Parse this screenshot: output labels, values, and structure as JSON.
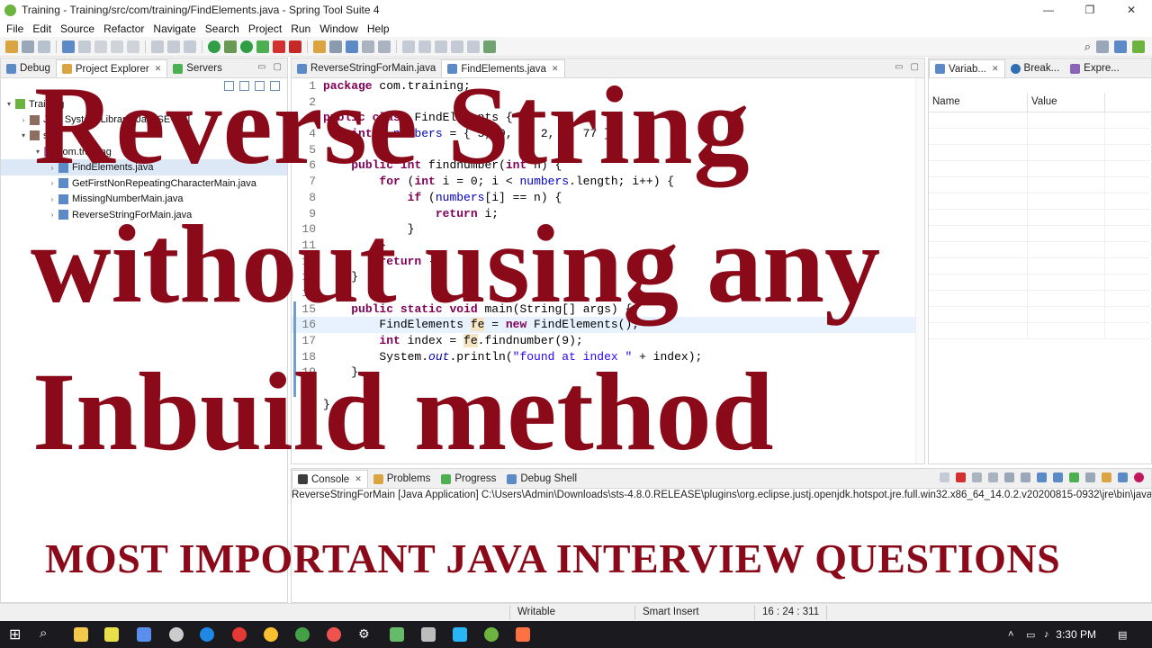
{
  "window": {
    "title": "Training - Training/src/com/training/FindElements.java - Spring Tool Suite 4",
    "controls": [
      "—",
      "❐",
      "✕"
    ]
  },
  "menu": [
    "File",
    "Edit",
    "Source",
    "Refactor",
    "Navigate",
    "Search",
    "Project",
    "Run",
    "Window",
    "Help"
  ],
  "left_panel": {
    "tabs": [
      "Debug",
      "Project Explorer",
      "Servers"
    ],
    "tree": [
      {
        "label": "Training",
        "indent": 0,
        "arrow": "▾"
      },
      {
        "label": "JRE System Library [JavaSE-1.8]",
        "indent": 1,
        "arrow": "›"
      },
      {
        "label": "src",
        "indent": 1,
        "arrow": "▾"
      },
      {
        "label": "com.training",
        "indent": 2,
        "arrow": "▾"
      },
      {
        "label": "FindElements.java",
        "indent": 3,
        "arrow": "›",
        "selected": true
      },
      {
        "label": "GetFirstNonRepeatingCharacterMain.java",
        "indent": 3,
        "arrow": "›"
      },
      {
        "label": "MissingNumberMain.java",
        "indent": 3,
        "arrow": "›"
      },
      {
        "label": "ReverseStringForMain.java",
        "indent": 3,
        "arrow": "›"
      }
    ]
  },
  "editor": {
    "tabs": [
      "ReverseStringForMain.java",
      "FindElements.java"
    ],
    "lines": [
      {
        "n": "1",
        "html": "<span class='kw'>package</span> com.training;"
      },
      {
        "n": "2",
        "html": ""
      },
      {
        "n": "3",
        "html": "<span class='kw'>public</span> <span class='kw'>class</span> FindElements {"
      },
      {
        "n": "4",
        "html": "    <span class='kw'>int</span>[] <span class='fld'>numbers</span> = { 5, 9, 6, 2, 5, 77 };"
      },
      {
        "n": "5",
        "html": ""
      },
      {
        "n": "6",
        "html": "    <span class='kw'>public</span> <span class='kw'>int</span> findnumber(<span class='kw'>int</span> n) {"
      },
      {
        "n": "7",
        "html": "        <span class='kw'>for</span> (<span class='kw'>int</span> i = 0; i &lt; <span class='fld'>numbers</span>.length; i++) {"
      },
      {
        "n": "8",
        "html": "            <span class='kw'>if</span> (<span class='fld'>numbers</span>[i] == n) {"
      },
      {
        "n": "9",
        "html": "                <span class='kw'>return</span> i;"
      },
      {
        "n": "10",
        "html": "            }"
      },
      {
        "n": "11",
        "html": "        }"
      },
      {
        "n": "12",
        "html": "        <span class='kw'>return</span> -1;"
      },
      {
        "n": "13",
        "html": "    }"
      },
      {
        "n": "14",
        "html": ""
      },
      {
        "n": "15",
        "html": "    <span class='kw'>public</span> <span class='kw'>static</span> <span class='kw'>void</span> main(String[] args) {"
      },
      {
        "n": "16",
        "html": "        FindElements <span class='occ'>fe</span> = <span class='kw'>new</span> FindElements();",
        "highlight": true
      },
      {
        "n": "17",
        "html": "        <span class='kw'>int</span> index = <span class='occ'>fe</span>.findnumber(9);"
      },
      {
        "n": "18",
        "html": "        System.<span class='sfld'>out</span>.println(<span class='str'>\"found at index \"</span> + index);"
      },
      {
        "n": "19",
        "html": "    }"
      },
      {
        "n": "20",
        "html": ""
      },
      {
        "n": "21",
        "html": "}"
      }
    ]
  },
  "right_panel": {
    "tabs": [
      "Variab...",
      "Break...",
      "Expre..."
    ],
    "columns": [
      "Name",
      "Value"
    ]
  },
  "console": {
    "tabs": [
      "Console",
      "Problems",
      "Progress",
      "Debug Shell"
    ],
    "launch_line": "ReverseStringForMain [Java Application] C:\\Users\\Admin\\Downloads\\sts-4.8.0.RELEASE\\plugins\\org.eclipse.justj.openjdk.hotspot.jre.full.win32.x86_64_14.0.2.v20200815-0932\\jre\\bin\\javaw.exe (Ma"
  },
  "status": {
    "writable": "Writable",
    "insert_mode": "Smart Insert",
    "position": "16 : 24 : 311"
  },
  "taskbar": {
    "time": "3:30 PM"
  },
  "overlay": {
    "line1": "Reverse String",
    "line2": "without using any",
    "line3": "Inbuild method",
    "line4": "MOST IMPORTANT JAVA INTERVIEW QUESTIONS"
  },
  "colors": {
    "overlay_text": "#8a0a1a",
    "keyword": "#7f0055",
    "string": "#2a00ff",
    "field": "#0000c0",
    "spring_green": "#6db33f"
  }
}
